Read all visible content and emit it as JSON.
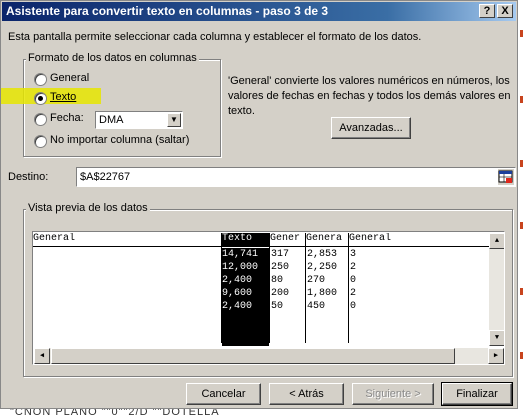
{
  "window": {
    "title": "Asistente para convertir texto en columnas - paso 3 de 3",
    "help_label": "?",
    "close_label": "X"
  },
  "description": "Esta pantalla permite seleccionar cada columna y establecer el formato de los datos.",
  "format_group": {
    "label": "Formato de los datos en columnas",
    "options": [
      {
        "label": "General",
        "selected": false
      },
      {
        "label": "Texto",
        "selected": true
      },
      {
        "label": "Fecha:",
        "selected": false
      },
      {
        "label": "No importar columna (saltar)",
        "selected": false
      }
    ],
    "date_format": "DMA"
  },
  "info_text": "'General' convierte los valores numéricos en números, los valores de fechas en fechas y todos los demás valores en texto.",
  "advanced_button": "Avanzadas...",
  "destination": {
    "label": "Destino:",
    "value": "$A$22767"
  },
  "preview": {
    "label": "Vista previa de los datos",
    "headers": [
      "General",
      "Texto",
      "Gener",
      "Genera",
      "General"
    ],
    "rows": [
      [
        "",
        "14,741",
        "317",
        "2,853",
        "3"
      ],
      [
        "",
        "12,000",
        "250",
        "2,250",
        "2"
      ],
      [
        "",
        "2,400",
        "80",
        "270",
        "0"
      ],
      [
        "",
        "9,600",
        "200",
        "1,800",
        "2"
      ],
      [
        "",
        "2,400",
        "50",
        "450",
        "0"
      ]
    ]
  },
  "buttons": {
    "cancel": "Cancelar",
    "back": "< Atrás",
    "next": "Siguiente >",
    "finish": "Finalizar"
  },
  "background_text": "\"CNON PLANO                \"\"0\"\"2/D \"\"DOTELLA",
  "colors": {
    "title_bar": "#0a246a",
    "dialog_bg": "#d4d0c8",
    "highlight": "#e6e600",
    "selected_column": "#000000"
  }
}
